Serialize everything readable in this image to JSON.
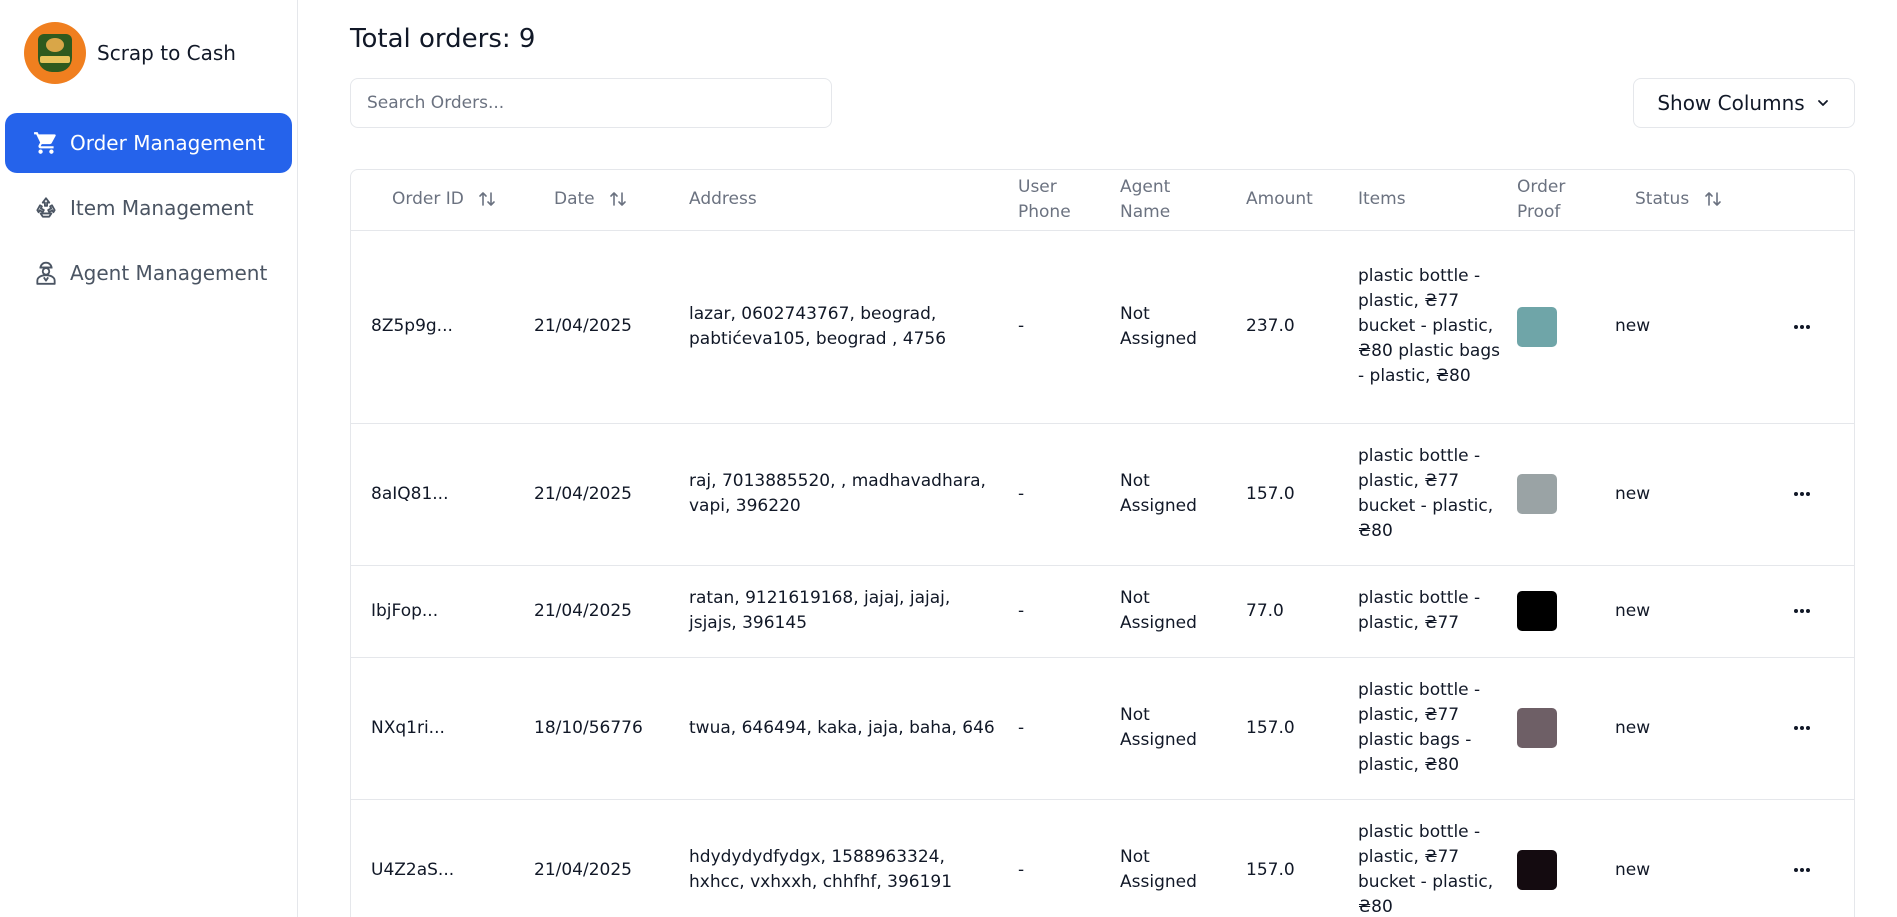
{
  "brand": {
    "name": "Scrap to Cash"
  },
  "sidebar": {
    "items": [
      {
        "label": "Order Management",
        "icon": "cart-icon",
        "active": true
      },
      {
        "label": "Item Management",
        "icon": "recycle-icon",
        "active": false
      },
      {
        "label": "Agent Management",
        "icon": "agent-icon",
        "active": false
      }
    ]
  },
  "main": {
    "total_label": "Total orders: 9",
    "search": {
      "placeholder": "Search Orders..."
    },
    "show_columns_label": "Show Columns"
  },
  "table": {
    "headers": {
      "order_id": "Order ID",
      "date": "Date",
      "address": "Address",
      "user_phone": "User Phone",
      "agent_name": "Agent Name",
      "amount": "Amount",
      "items": "Items",
      "order_proof": "Order Proof",
      "status": "Status"
    },
    "rows": [
      {
        "order_id": "8Z5p9g...",
        "date": "21/04/2025",
        "address": "lazar, 0602743767, beograd, pabtićeva105, beograd , 4756",
        "user_phone": "-",
        "agent_name": "Not Assigned",
        "amount": "237.0",
        "items": "plastic bottle - plastic, ₴77 bucket - plastic, ₴80 plastic bags - plastic, ₴80",
        "proof_color": "#6fa5a8",
        "status": "new"
      },
      {
        "order_id": "8aIQ81...",
        "date": "21/04/2025",
        "address": "raj, 7013885520, , madhavadhara, vapi, 396220",
        "user_phone": "-",
        "agent_name": "Not Assigned",
        "amount": "157.0",
        "items": "plastic bottle - plastic, ₴77 bucket - plastic, ₴80",
        "proof_color": "#9aa3a5",
        "status": "new"
      },
      {
        "order_id": "IbjFop...",
        "date": "21/04/2025",
        "address": "ratan, 9121619168, jajaj, jajaj, jsjajs, 396145",
        "user_phone": "-",
        "agent_name": "Not Assigned",
        "amount": "77.0",
        "items": "plastic bottle - plastic, ₴77",
        "proof_color": "#000000",
        "status": "new"
      },
      {
        "order_id": "NXq1ri...",
        "date": "18/10/56776",
        "address": "twua, 646494, kaka, jaja, baha, 646",
        "user_phone": "-",
        "agent_name": "Not Assigned",
        "amount": "157.0",
        "items": "plastic bottle - plastic, ₴77 plastic bags - plastic, ₴80",
        "proof_color": "#6e5f66",
        "status": "new"
      },
      {
        "order_id": "U4Z2aS...",
        "date": "21/04/2025",
        "address": "hdydydydfydgx, 1588963324, hxhcc, vxhxxh, chhfhf, 396191",
        "user_phone": "-",
        "agent_name": "Not Assigned",
        "amount": "157.0",
        "items": "plastic bottle - plastic, ₴77 bucket - plastic, ₴80",
        "proof_color": "#140b10",
        "status": "new"
      }
    ]
  }
}
